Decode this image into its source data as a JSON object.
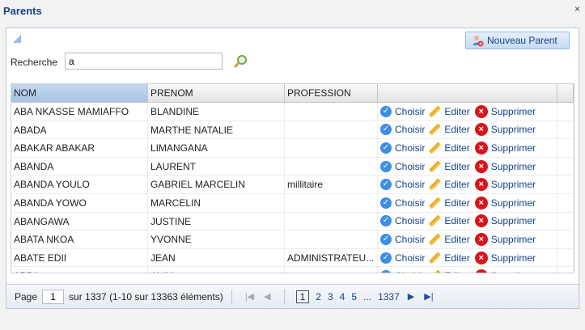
{
  "window": {
    "title": "Parents",
    "close_glyph": "×"
  },
  "toolbar": {
    "new_parent_label": "Nouveau Parent"
  },
  "search": {
    "label": "Recherche",
    "value": "a"
  },
  "table": {
    "columns": [
      "NOM",
      "PRENOM",
      "PROFESSION"
    ],
    "rows": [
      {
        "nom": "ABA NKASSE MAMIAFFO",
        "prenom": "BLANDINE",
        "profession": ""
      },
      {
        "nom": "ABADA",
        "prenom": "MARTHE NATALIE",
        "profession": ""
      },
      {
        "nom": "ABAKAR ABAKAR",
        "prenom": "LIMANGANA",
        "profession": ""
      },
      {
        "nom": "ABANDA",
        "prenom": "LAURENT",
        "profession": ""
      },
      {
        "nom": "ABANDA YOULO",
        "prenom": "GABRIEL MARCELIN",
        "profession": "millitaire"
      },
      {
        "nom": "ABANDA YOWO",
        "prenom": "MARCELIN",
        "profession": ""
      },
      {
        "nom": "ABANGAWA",
        "prenom": "JUSTINE",
        "profession": ""
      },
      {
        "nom": "ABATA NKOA",
        "prenom": "YVONNE",
        "profession": ""
      },
      {
        "nom": "ABATE EDII",
        "prenom": "JEAN",
        "profession": "ADMINISTRATEU..."
      },
      {
        "nom": "ABBA",
        "prenom": "ALIM",
        "profession": ""
      }
    ],
    "actions": {
      "choose": "Choisir",
      "edit": "Editer",
      "delete": "Supprimer"
    }
  },
  "pager": {
    "page_label": "Page",
    "page_value": "1",
    "summary": "sur 1337 (1-10 sur 13363 éléments)",
    "pages": [
      "1",
      "2",
      "3",
      "4",
      "5",
      "...",
      "1337"
    ],
    "current_page": "1"
  }
}
